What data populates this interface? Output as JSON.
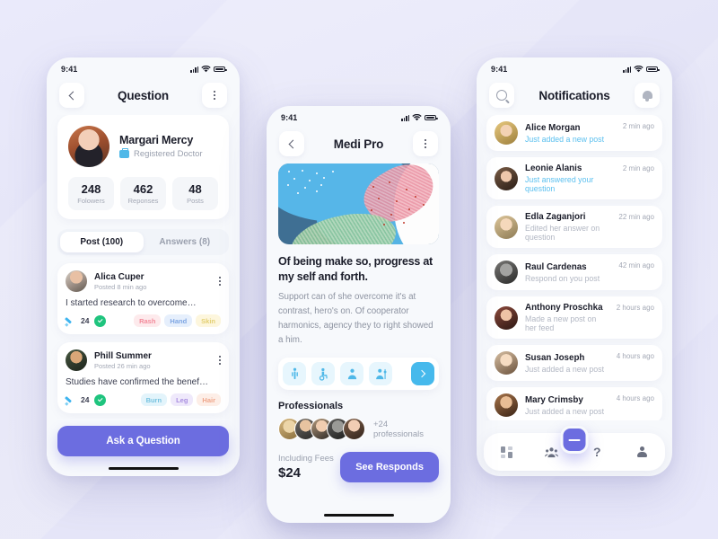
{
  "background": {
    "base_color": "#e6e6f7"
  },
  "accent": {
    "primary": "#6c6de0",
    "blue": "#56b6e8",
    "green": "#1fc47e"
  },
  "phone_left": {
    "status": {
      "time": "9:41"
    },
    "header": {
      "title": "Question",
      "back_icon": "chevron-left-icon",
      "menu_icon": "more-vertical-icon"
    },
    "profile": {
      "name": "Margari Mercy",
      "role": "Registered Doctor",
      "role_icon": "briefcase-icon",
      "stats": [
        {
          "value": "248",
          "label": "Folowers"
        },
        {
          "value": "462",
          "label": "Reponses"
        },
        {
          "value": "48",
          "label": "Posts"
        }
      ]
    },
    "tabs": [
      {
        "label": "Post (100)",
        "active": true
      },
      {
        "label": "Answers (8)",
        "active": false
      }
    ],
    "posts": [
      {
        "name": "Alica Cuper",
        "time": "Posted 8 min ago",
        "text": "I started research to overcome…",
        "count": "24",
        "pen_icon": "pen-icon",
        "verified_icon": "check-circle-icon",
        "menu_icon": "more-vertical-icon",
        "tags": [
          {
            "label": "Rash",
            "bg": "#fdeaec",
            "fg": "#f3899a"
          },
          {
            "label": "Hand",
            "bg": "#e6effc",
            "fg": "#7ea6e3"
          },
          {
            "label": "Skin",
            "bg": "#fdf6dd",
            "fg": "#e3cf72"
          }
        ]
      },
      {
        "name": "Phill Summer",
        "time": "Posted 26 min ago",
        "text": "Studies have confirmed the benef…",
        "count": "24",
        "pen_icon": "pen-icon",
        "verified_icon": "check-circle-icon",
        "menu_icon": "more-vertical-icon",
        "tags": [
          {
            "label": "Burn",
            "bg": "#e3f4fb",
            "fg": "#76c3e0"
          },
          {
            "label": "Leg",
            "bg": "#efe9fb",
            "fg": "#a98ee0"
          },
          {
            "label": "Hair",
            "bg": "#fdeee7",
            "fg": "#efa68b"
          }
        ]
      }
    ],
    "cta": {
      "label": "Ask a Question"
    }
  },
  "phone_mid": {
    "status": {
      "time": "9:41"
    },
    "header": {
      "title": "Medi Pro",
      "back_icon": "chevron-left-icon",
      "menu_icon": "more-vertical-icon"
    },
    "hero": {
      "alt": "abstract-illustration"
    },
    "headline": "Of being make so, progress at my self and forth.",
    "paragraph": "Support can of she overcome it's at contrast, hero's on. Of cooperator harmonics, agency they to right showed a him.",
    "category_icons": [
      {
        "name": "patient-standing-icon"
      },
      {
        "name": "wheelchair-icon"
      },
      {
        "name": "doctor-icon"
      },
      {
        "name": "nurse-icon"
      }
    ],
    "next_icon": "chevron-right-icon",
    "professionals": {
      "title": "Professionals",
      "more_label": "+24 professionals",
      "avatars": 5
    },
    "fees": {
      "label": "Including Fees",
      "value": "$24"
    },
    "cta": {
      "label": "See Responds"
    }
  },
  "phone_right": {
    "status": {
      "time": "9:41"
    },
    "header": {
      "title": "Notifications",
      "search_icon": "search-icon",
      "bell_icon": "bell-icon"
    },
    "notifications": [
      {
        "name": "Alice Morgan",
        "action": "Just added a new post",
        "time": "2 min ago",
        "highlight": true
      },
      {
        "name": "Leonie Alanis",
        "action": "Just answered your question",
        "time": "2 min ago",
        "highlight": true
      },
      {
        "name": "Edla Zaganjori",
        "action": "Edited her answer on question",
        "time": "22 min ago",
        "highlight": false
      },
      {
        "name": "Raul Cardenas",
        "action": "Respond on you post",
        "time": "42 min ago",
        "highlight": false
      },
      {
        "name": "Anthony Proschka",
        "action": "Made a new post on her feed",
        "time": "2 hours ago",
        "highlight": false
      },
      {
        "name": "Susan Joseph",
        "action": "Just added a new post",
        "time": "4 hours ago",
        "highlight": false
      },
      {
        "name": "Mary Crimsby",
        "action": "Just added a new post",
        "time": "4 hours ago",
        "highlight": false
      }
    ],
    "fab": {
      "icon": "plus-icon"
    },
    "tabbar": [
      {
        "icon": "dashboard-grid-icon"
      },
      {
        "icon": "community-group-icon"
      },
      {
        "icon": "help-question-icon"
      },
      {
        "icon": "profile-person-icon"
      }
    ]
  }
}
